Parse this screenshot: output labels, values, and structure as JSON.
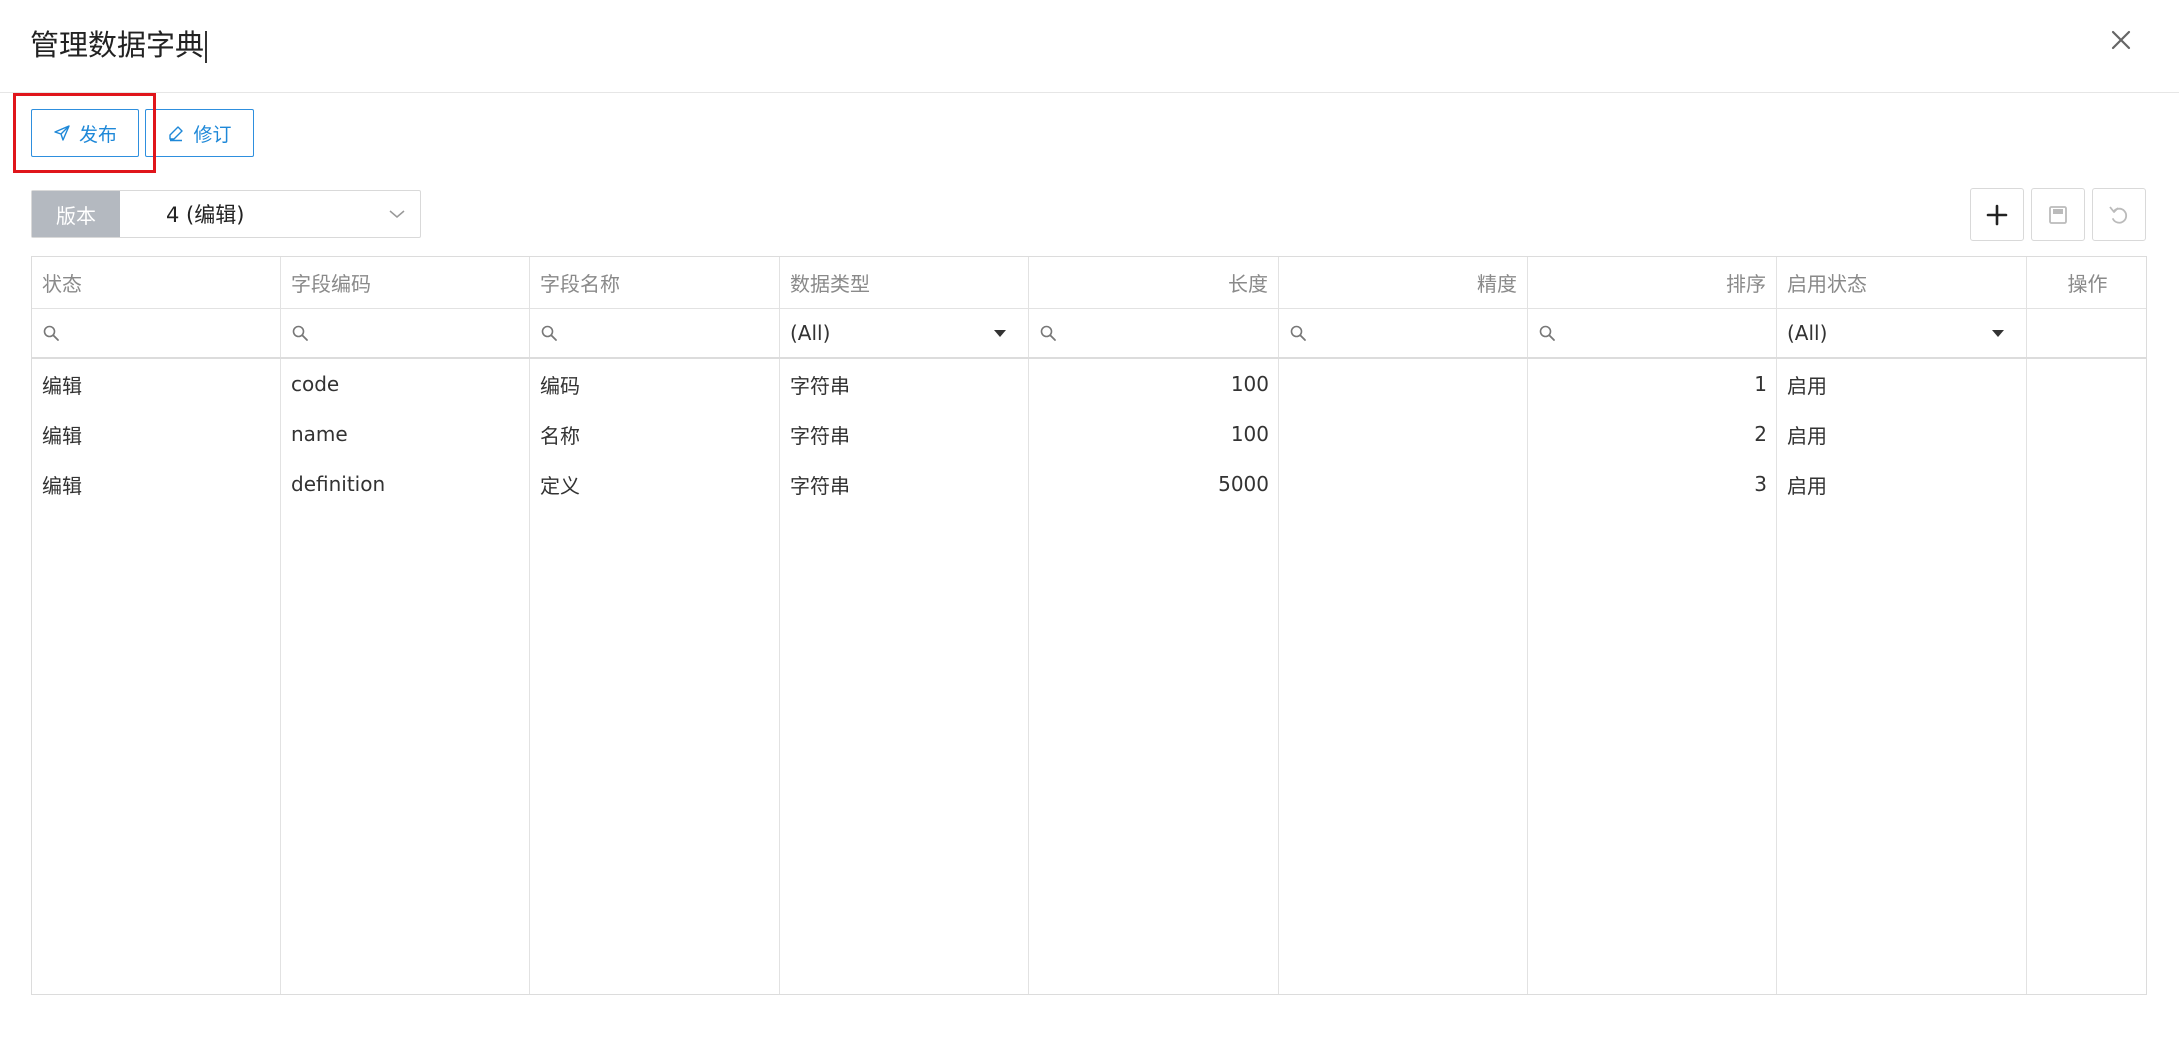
{
  "dialog": {
    "title": "管理数据字典",
    "close_icon": "close-icon"
  },
  "toolbar": {
    "publish_label": "发布",
    "publish_icon": "send-icon",
    "revise_label": "修订",
    "revise_icon": "pencil-icon",
    "add_icon": "plus-icon",
    "save_icon": "save-icon",
    "undo_icon": "undo-icon"
  },
  "version": {
    "label": "版本",
    "selected": "4 (编辑)"
  },
  "grid": {
    "columns": [
      "状态",
      "字段编码",
      "字段名称",
      "数据类型",
      "长度",
      "精度",
      "排序",
      "启用状态",
      "操作"
    ],
    "filters": {
      "data_type": "(All)",
      "enable_status": "(All)"
    },
    "rows": [
      {
        "status": "编辑",
        "code": "code",
        "name": "编码",
        "type": "字符串",
        "length": "100",
        "precision": "",
        "order": "1",
        "enabled": "启用"
      },
      {
        "status": "编辑",
        "code": "name",
        "name": "名称",
        "type": "字符串",
        "length": "100",
        "precision": "",
        "order": "2",
        "enabled": "启用"
      },
      {
        "status": "编辑",
        "code": "definition",
        "name": "定义",
        "type": "字符串",
        "length": "5000",
        "precision": "",
        "order": "3",
        "enabled": "启用"
      }
    ]
  },
  "colors": {
    "accent": "#1e88d8",
    "highlight": "#e0151b",
    "version_label_bg": "#b4b9c0"
  }
}
